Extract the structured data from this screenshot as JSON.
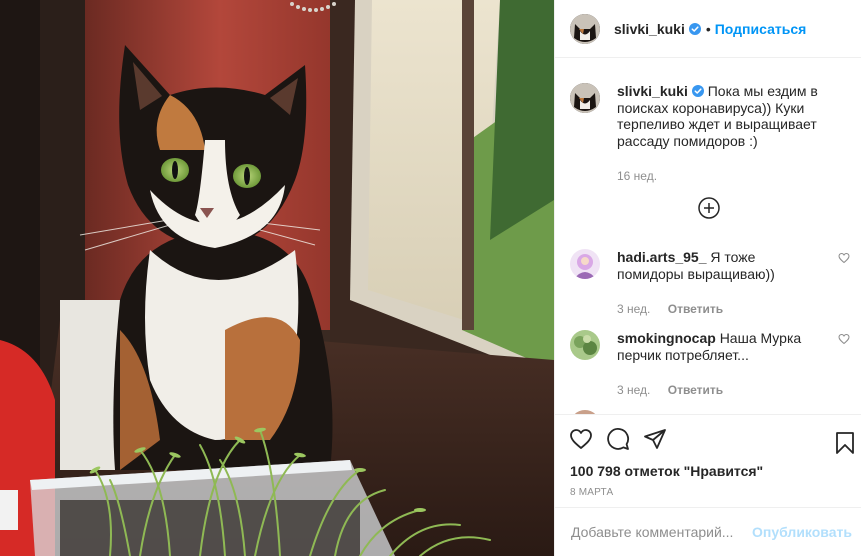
{
  "post": {
    "image_alt": "Calico cat on window sill with tomato seedlings",
    "author": {
      "username": "slivki_kuki",
      "verified": true,
      "avatar_icon": "cat-avatar"
    },
    "header": {
      "separator": "•",
      "follow_label": "Подписаться"
    },
    "caption": {
      "username": "slivki_kuki",
      "text": "Пока мы ездим в поисках коронавируса)) Куки терпеливо ждет и выращивает рассаду помидоров :)",
      "time": "16 нед."
    },
    "load_more_icon": "plus-circle-icon",
    "comments": [
      {
        "username": "hadi.arts_95_",
        "text": "Я тоже помидоры выращиваю))",
        "time": "3 нед.",
        "reply_label": "Ответить",
        "avatar_color": "#d9a8e6"
      },
      {
        "username": "smokingnocap",
        "text": "Наша Мурка перчик потребляет...",
        "time": "3 нед.",
        "reply_label": "Ответить",
        "avatar_color": "#7aa35c"
      }
    ],
    "actions": {
      "like_icon": "heart-icon",
      "comment_icon": "comment-icon",
      "share_icon": "share-icon",
      "save_icon": "bookmark-icon"
    },
    "likes": "100 798 отметок \"Нравится\"",
    "date": "8 МАРТА",
    "add_comment": {
      "placeholder": "Добавьте комментарий...",
      "publish_label": "Опубликовать"
    }
  },
  "colors": {
    "link_blue": "#0095f6",
    "publish_disabled": "#b2dffc",
    "muted": "#8e8e8e",
    "border": "#efefef"
  }
}
